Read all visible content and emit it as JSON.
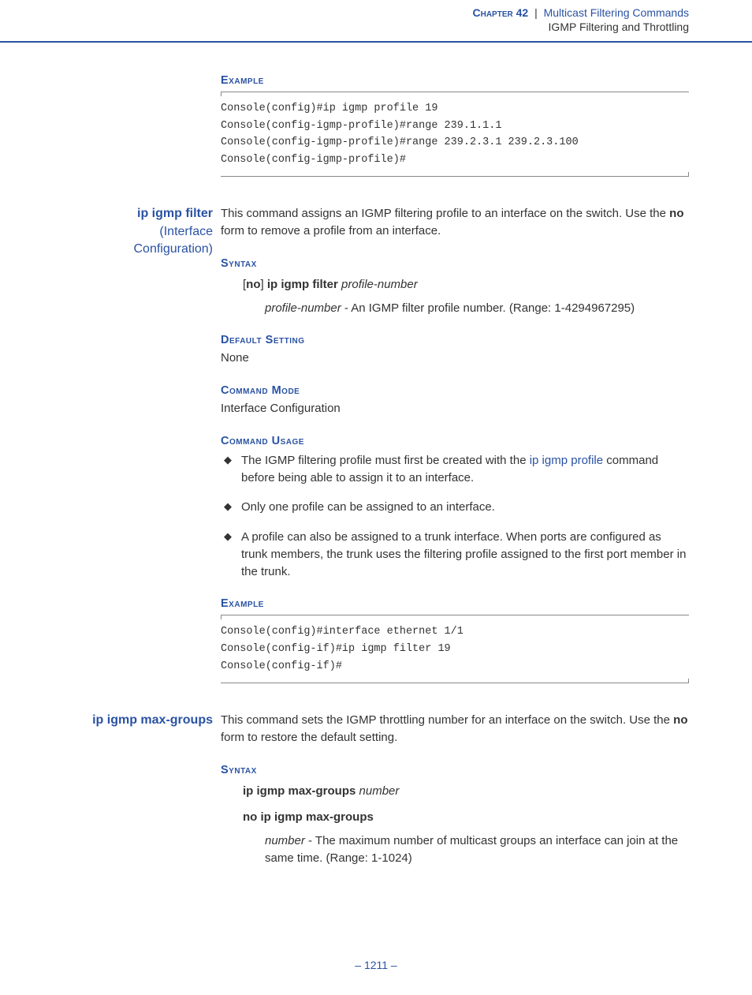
{
  "header": {
    "chapter_label": "Chapter 42",
    "divider": "|",
    "chapter_title": "Multicast Filtering Commands",
    "subtitle": "IGMP Filtering and Throttling"
  },
  "sec1": {
    "example_title": "Example",
    "code": "Console(config)#ip igmp profile 19\nConsole(config-igmp-profile)#range 239.1.1.1\nConsole(config-igmp-profile)#range 239.2.3.1 239.2.3.100\nConsole(config-igmp-profile)#"
  },
  "cmd1": {
    "name": "ip igmp filter",
    "sub1": "(Interface",
    "sub2": "Configuration)",
    "desc_pre": "This command assigns an IGMP filtering profile to an interface on the switch. Use the ",
    "desc_bold": "no",
    "desc_post": " form to remove a profile from an interface.",
    "syntax_title": "Syntax",
    "syntax_lb": "[",
    "syntax_no": "no",
    "syntax_rb": "] ",
    "syntax_cmd": "ip igmp filter",
    "syntax_arg": " profile-number",
    "arg_name": "profile-number",
    "arg_desc": " - An IGMP filter profile number. (Range: 1-4294967295)",
    "default_title": "Default Setting",
    "default_val": "None",
    "mode_title": "Command Mode",
    "mode_val": "Interface Configuration",
    "usage_title": "Command Usage",
    "bullet1_pre": "The IGMP filtering profile must first be created with the ",
    "bullet1_link": "ip igmp profile",
    "bullet1_post": " command before being able to assign it to an interface.",
    "bullet2": "Only one profile can be assigned to an interface.",
    "bullet3": "A profile can also be assigned to a trunk interface. When ports are configured as trunk members, the trunk uses the filtering profile assigned to the first port member in the trunk.",
    "example_title": "Example",
    "code": "Console(config)#interface ethernet 1/1\nConsole(config-if)#ip igmp filter 19\nConsole(config-if)#"
  },
  "cmd2": {
    "name": "ip igmp max-groups",
    "desc_pre": "This command sets the IGMP throttling number for an interface on the switch. Use the ",
    "desc_bold": "no",
    "desc_post": " form to restore the default setting.",
    "syntax_title": "Syntax",
    "syntax_line1_cmd": "ip igmp max-groups",
    "syntax_line1_arg": " number",
    "syntax_line2": "no ip igmp max-groups",
    "arg_name": "number",
    "arg_desc": " - The maximum number of multicast groups an interface can join at the same time. (Range: 1-1024)"
  },
  "footer": {
    "page": "–  1211  –"
  }
}
